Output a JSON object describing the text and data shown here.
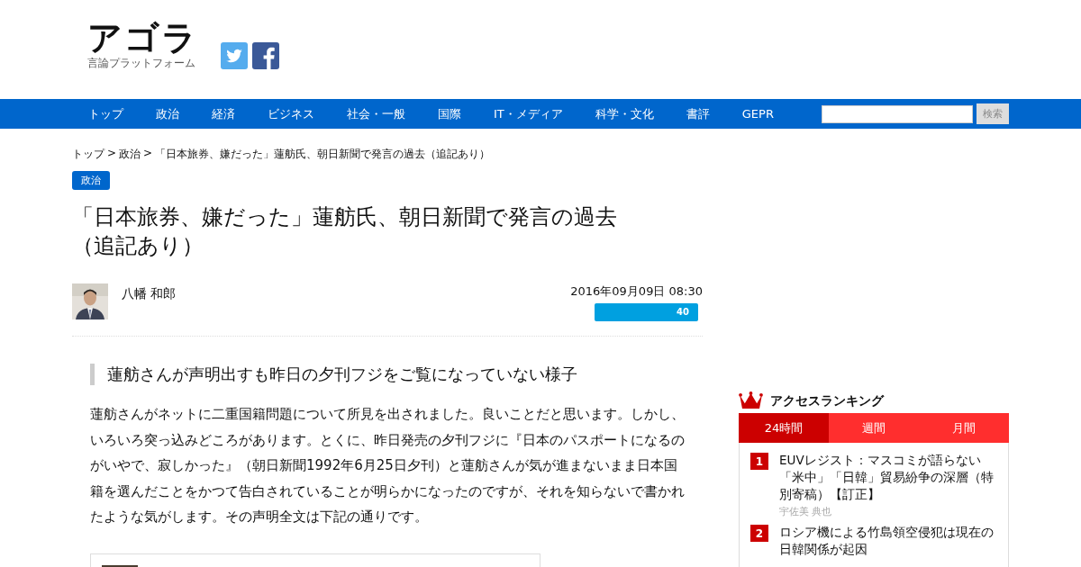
{
  "logo": {
    "title": "アゴラ",
    "subtitle": "言論プラットフォーム"
  },
  "nav": {
    "items": [
      "トップ",
      "政治",
      "経済",
      "ビジネス",
      "社会・一般",
      "国際",
      "IT・メディア",
      "科学・文化",
      "書評",
      "GEPR"
    ],
    "search_button": "検索"
  },
  "breadcrumb_separator": ">",
  "breadcrumb": [
    "トップ",
    "政治",
    "「日本旅券、嫌だった」蓮舫氏、朝日新聞で発言の過去（追記あり）"
  ],
  "category": "政治",
  "article": {
    "title": "「日本旅券、嫌だった」蓮舫氏、朝日新聞で発言の過去（追記あり）",
    "author": "八幡 和郎",
    "date": "2016年09月09日 08:30",
    "share_count": "40",
    "heading": "蓮舫さんが声明出すも昨日の夕刊フジをご覧になっていない様子",
    "body": "蓮舫さんがネットに二重国籍問題について所見を出されました。良いことだと思います。しかし、いろいろ突っ込みどころがあります。とくに、昨日発売の夕刊フジに『日本のパスポートになるのがいやで、寂しかった』（朝日新聞1992年6月25日夕刊）と蓮舫さんが気が進まないまま日本国籍を選んだことをかつて告白されていることが明らかになったのですが、それを知らないで書かれたような気がします。その声明全文は下記の通りです。"
  },
  "ranking": {
    "title": "アクセスランキング",
    "tabs": [
      {
        "label": "24時間",
        "selected": true
      },
      {
        "label": "週間",
        "selected": false
      },
      {
        "label": "月間",
        "selected": false
      }
    ],
    "items": [
      {
        "rank": "1",
        "title": "EUVレジスト：マスコミが語らない「米中」「日韓」貿易紛争の深層（特別寄稿）【訂正】",
        "author": "宇佐美 典也"
      },
      {
        "rank": "2",
        "title": "ロシア機による竹島領空侵犯は現在の日韓関係が起因"
      }
    ]
  }
}
